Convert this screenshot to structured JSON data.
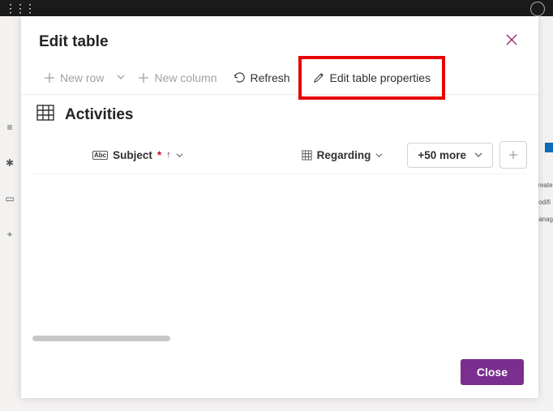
{
  "panel": {
    "title": "Edit table",
    "close_button": "Close"
  },
  "toolbar": {
    "new_row": "New row",
    "new_column": "New column",
    "refresh": "Refresh",
    "edit_props": "Edit table properties"
  },
  "table": {
    "name": "Activities",
    "columns": {
      "subject": {
        "label": "Subject",
        "required": "*",
        "sort_dir": "↑"
      },
      "regarding": {
        "label": "Regarding"
      }
    },
    "more_columns": "+50 more"
  },
  "bg": {
    "labels": [
      "Create",
      "Modifi",
      "Manag"
    ]
  }
}
